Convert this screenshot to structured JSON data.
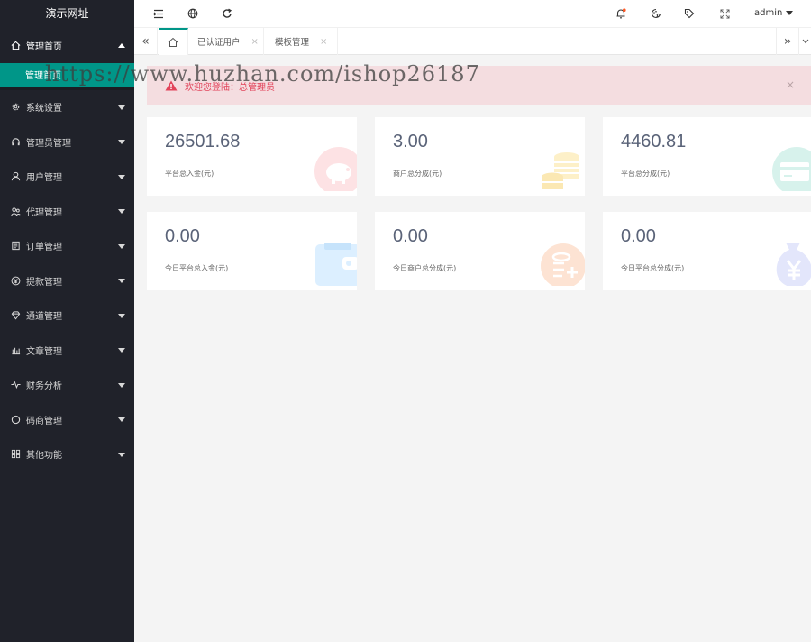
{
  "sidebar": {
    "logo": "演示网址",
    "items": [
      {
        "label": "管理首页",
        "icon": "home-icon",
        "open": true
      },
      {
        "label": "系统设置",
        "icon": "gear-icon"
      },
      {
        "label": "管理员管理",
        "icon": "headset-icon"
      },
      {
        "label": "用户管理",
        "icon": "user-icon"
      },
      {
        "label": "代理管理",
        "icon": "agent-icon"
      },
      {
        "label": "订单管理",
        "icon": "order-icon"
      },
      {
        "label": "提款管理",
        "icon": "yen-icon"
      },
      {
        "label": "通道管理",
        "icon": "diamond-icon"
      },
      {
        "label": "文章管理",
        "icon": "article-icon"
      },
      {
        "label": "财务分析",
        "icon": "pulse-icon"
      },
      {
        "label": "码商管理",
        "icon": "circle-icon"
      },
      {
        "label": "其他功能",
        "icon": "apps-icon"
      }
    ],
    "submenu": [
      {
        "label": "管理首页"
      }
    ]
  },
  "header": {
    "user": "admin",
    "icons": [
      "menu-toggle-icon",
      "globe-icon",
      "refresh-icon",
      "bell-icon",
      "theme-icon",
      "tag-icon",
      "fullscreen-icon"
    ],
    "accent": "#009688",
    "notice_dot": "#ff5722"
  },
  "tabs": {
    "items": [
      {
        "label": "已认证用户",
        "close": "×"
      },
      {
        "label": "模板管理",
        "close": "×"
      }
    ],
    "prev": "«",
    "next": "»"
  },
  "alert": {
    "text": "欢迎您登陆：总管理员",
    "close": "×",
    "color": "#e2435a"
  },
  "cards": [
    {
      "value": "26501.68",
      "label": "平台总入金(元)",
      "icon": "piggy-bank-icon",
      "color": "#fde2e4"
    },
    {
      "value": "3.00",
      "label": "商户总分成(元)",
      "icon": "coins-icon",
      "color": "#fdf0c8"
    },
    {
      "value": "4460.81",
      "label": "平台总分成(元)",
      "icon": "card-icon",
      "color": "#d7f2ec"
    },
    {
      "value": "0.00",
      "label": "今日平台总入金(元)",
      "icon": "wallet-icon",
      "color": "#dcefff"
    },
    {
      "value": "0.00",
      "label": "今日商户总分成(元)",
      "icon": "coin-plus-icon",
      "color": "#fde3d3"
    },
    {
      "value": "0.00",
      "label": "今日平台总分成(元)",
      "icon": "money-bag-icon",
      "color": "#e3e6fb"
    }
  ],
  "watermark": "https://www.huzhan.com/ishop26187"
}
